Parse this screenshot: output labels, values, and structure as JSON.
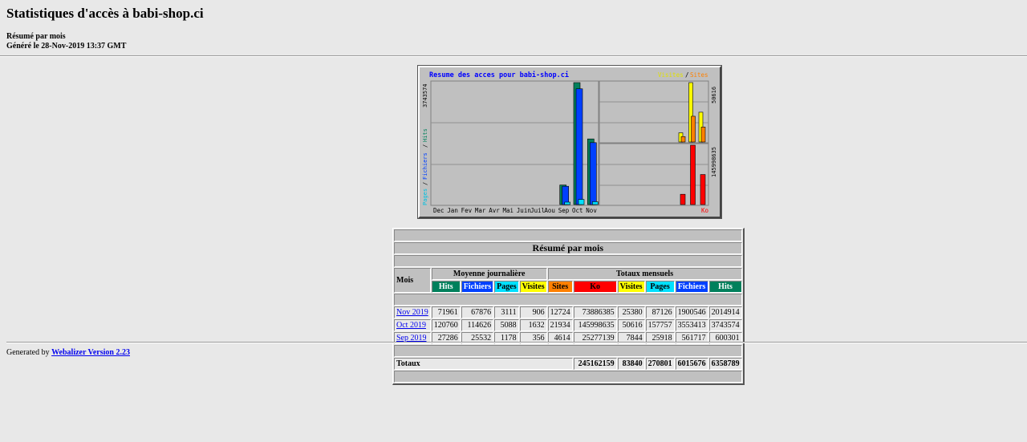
{
  "page": {
    "title": "Statistiques d'accès à babi-shop.ci",
    "subtitle": "Résumé par mois",
    "generated": "Généré le 28-Nov-2019 13:37 GMT"
  },
  "graph": {
    "title": "Resume des acces pour babi-shop.ci",
    "legend_visits": "Visites",
    "legend_slash": "/",
    "legend_sites": "Sites",
    "left_axis_max": "3743574",
    "left_axis_label_hits": "Hits",
    "left_axis_label_files": "Fichiers",
    "left_axis_label_pages": "Pages",
    "left_axis_sep": "/",
    "right_top_max": "50616",
    "right_bottom_max": "145998635",
    "kb_label": "Ko",
    "months": [
      "Dec",
      "Jan",
      "Fev",
      "Mar",
      "Avr",
      "Mai",
      "Juin",
      "Juil",
      "Aou",
      "Sep",
      "Oct",
      "Nov"
    ],
    "colors": {
      "hits": "#00805c",
      "files": "#0040ff",
      "pages": "#00e0ff",
      "visits": "#ffff00",
      "sites": "#ff8000",
      "kb": "#ff0000",
      "title": "#0000ff"
    }
  },
  "chart_data": {
    "type": "bar",
    "categories": [
      "Dec",
      "Jan",
      "Fev",
      "Mar",
      "Avr",
      "Mai",
      "Juin",
      "Juil",
      "Aou",
      "Sep",
      "Oct",
      "Nov"
    ],
    "title": "Resume des acces pour babi-shop.ci",
    "series": [
      {
        "name": "Hits",
        "values": [
          0,
          0,
          0,
          0,
          0,
          0,
          0,
          0,
          0,
          600301,
          3743574,
          2014914
        ]
      },
      {
        "name": "Fichiers",
        "values": [
          0,
          0,
          0,
          0,
          0,
          0,
          0,
          0,
          0,
          561717,
          3553413,
          1900546
        ]
      },
      {
        "name": "Pages",
        "values": [
          0,
          0,
          0,
          0,
          0,
          0,
          0,
          0,
          0,
          25918,
          157757,
          87126
        ]
      },
      {
        "name": "Visites",
        "values": [
          0,
          0,
          0,
          0,
          0,
          0,
          0,
          0,
          0,
          7844,
          50616,
          25380
        ]
      },
      {
        "name": "Sites",
        "values": [
          0,
          0,
          0,
          0,
          0,
          0,
          0,
          0,
          0,
          4614,
          21934,
          12724
        ]
      },
      {
        "name": "Ko",
        "values": [
          0,
          0,
          0,
          0,
          0,
          0,
          0,
          0,
          0,
          25277139,
          145998635,
          73886385
        ]
      }
    ]
  },
  "table": {
    "title": "Résumé par mois",
    "col_month": "Mois",
    "group_daily": "Moyenne journalière",
    "group_monthly": "Totaux mensuels",
    "daily_headers": [
      {
        "label": "Hits",
        "bg": "#00805c",
        "fg": "#ffffff"
      },
      {
        "label": "Fichiers",
        "bg": "#0040ff",
        "fg": "#ffffff"
      },
      {
        "label": "Pages",
        "bg": "#00e0ff",
        "fg": "#000000"
      },
      {
        "label": "Visites",
        "bg": "#ffff00",
        "fg": "#000000"
      }
    ],
    "monthly_headers": [
      {
        "label": "Sites",
        "bg": "#ff8000",
        "fg": "#000000"
      },
      {
        "label": "Ko",
        "bg": "#ff0000",
        "fg": "#000000"
      },
      {
        "label": "Visites",
        "bg": "#ffff00",
        "fg": "#000000"
      },
      {
        "label": "Pages",
        "bg": "#00e0ff",
        "fg": "#000000"
      },
      {
        "label": "Fichiers",
        "bg": "#0040ff",
        "fg": "#ffffff"
      },
      {
        "label": "Hits",
        "bg": "#00805c",
        "fg": "#ffffff"
      }
    ],
    "rows": [
      {
        "month": "Nov 2019",
        "values": [
          "71961",
          "67876",
          "3111",
          "906",
          "12724",
          "73886385",
          "25380",
          "87126",
          "1900546",
          "2014914"
        ]
      },
      {
        "month": "Oct 2019",
        "values": [
          "120760",
          "114626",
          "5088",
          "1632",
          "21934",
          "145998635",
          "50616",
          "157757",
          "3553413",
          "3743574"
        ]
      },
      {
        "month": "Sep 2019",
        "values": [
          "27286",
          "25532",
          "1178",
          "356",
          "4614",
          "25277139",
          "7844",
          "25918",
          "561717",
          "600301"
        ]
      }
    ],
    "totals": {
      "label": "Totaux",
      "ko": "245162159",
      "visits": "83840",
      "pages": "270801",
      "files": "6015676",
      "hits": "6358789"
    }
  },
  "footer": {
    "prefix": "Generated by",
    "link": "Webalizer Version 2.23"
  }
}
